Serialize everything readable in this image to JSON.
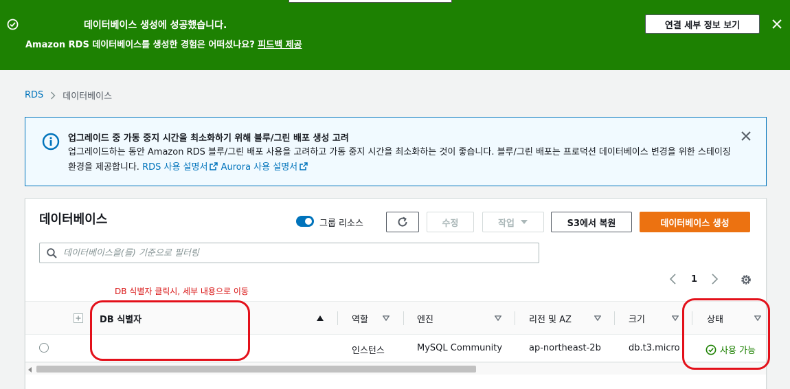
{
  "flash": {
    "title": "데이터베이스 생성에 성공했습니다.",
    "message": "Amazon RDS 데이터베이스를 생성한 경험은 어떠셨나요? ",
    "feedback_link": "피드백 제공",
    "view_details_button": "연결 세부 정보 보기",
    "color": "#1d8102",
    "icons": [
      "success-check-icon",
      "close-icon"
    ]
  },
  "breadcrumb": {
    "root": "RDS",
    "current": "데이터베이스"
  },
  "info_alert": {
    "title": "업그레이드 중 가동 중지 시간을 최소화하기 위해 블루/그린 배포 생성 고려",
    "body": "업그레이드하는 동안 Amazon RDS 블루/그린 배포 사용을 고려하고 가동 중지 시간을 최소화하는 것이 좋습니다. 블루/그린 배포는 프로덕션 데이터베이스 변경을 위한 스테이징 환경을 제공합니다. ",
    "rds_guide_link": "RDS 사용 설명서",
    "aurora_guide_link": "Aurora 사용 설명서",
    "icons": [
      "info-icon",
      "external-link-icon",
      "close-icon"
    ]
  },
  "databases": {
    "title": "데이터베이스",
    "group_resources_label": "그룹 리소스",
    "group_resources_on": true,
    "modify_button": "수정",
    "actions_button": "작업",
    "restore_s3_button": "S3에서 복원",
    "create_button": "데이터베이스 생성",
    "accent_color": "#ec7211",
    "search_placeholder": "데이터베이스을(를) 기준으로 필터링",
    "page": "1",
    "annotation": "DB 식별자 클릭시, 세부 내용으로 이동",
    "columns": {
      "identifier": "DB 식별자",
      "role": "역할",
      "engine": "엔진",
      "region_az": "리전 및 AZ",
      "size": "크기",
      "status": "상태"
    },
    "rows": [
      {
        "identifier": "",
        "role": "인스턴스",
        "engine": "MySQL Community",
        "region_az": "ap-northeast-2b",
        "size": "db.t3.micro",
        "status": "사용 가능"
      }
    ]
  }
}
